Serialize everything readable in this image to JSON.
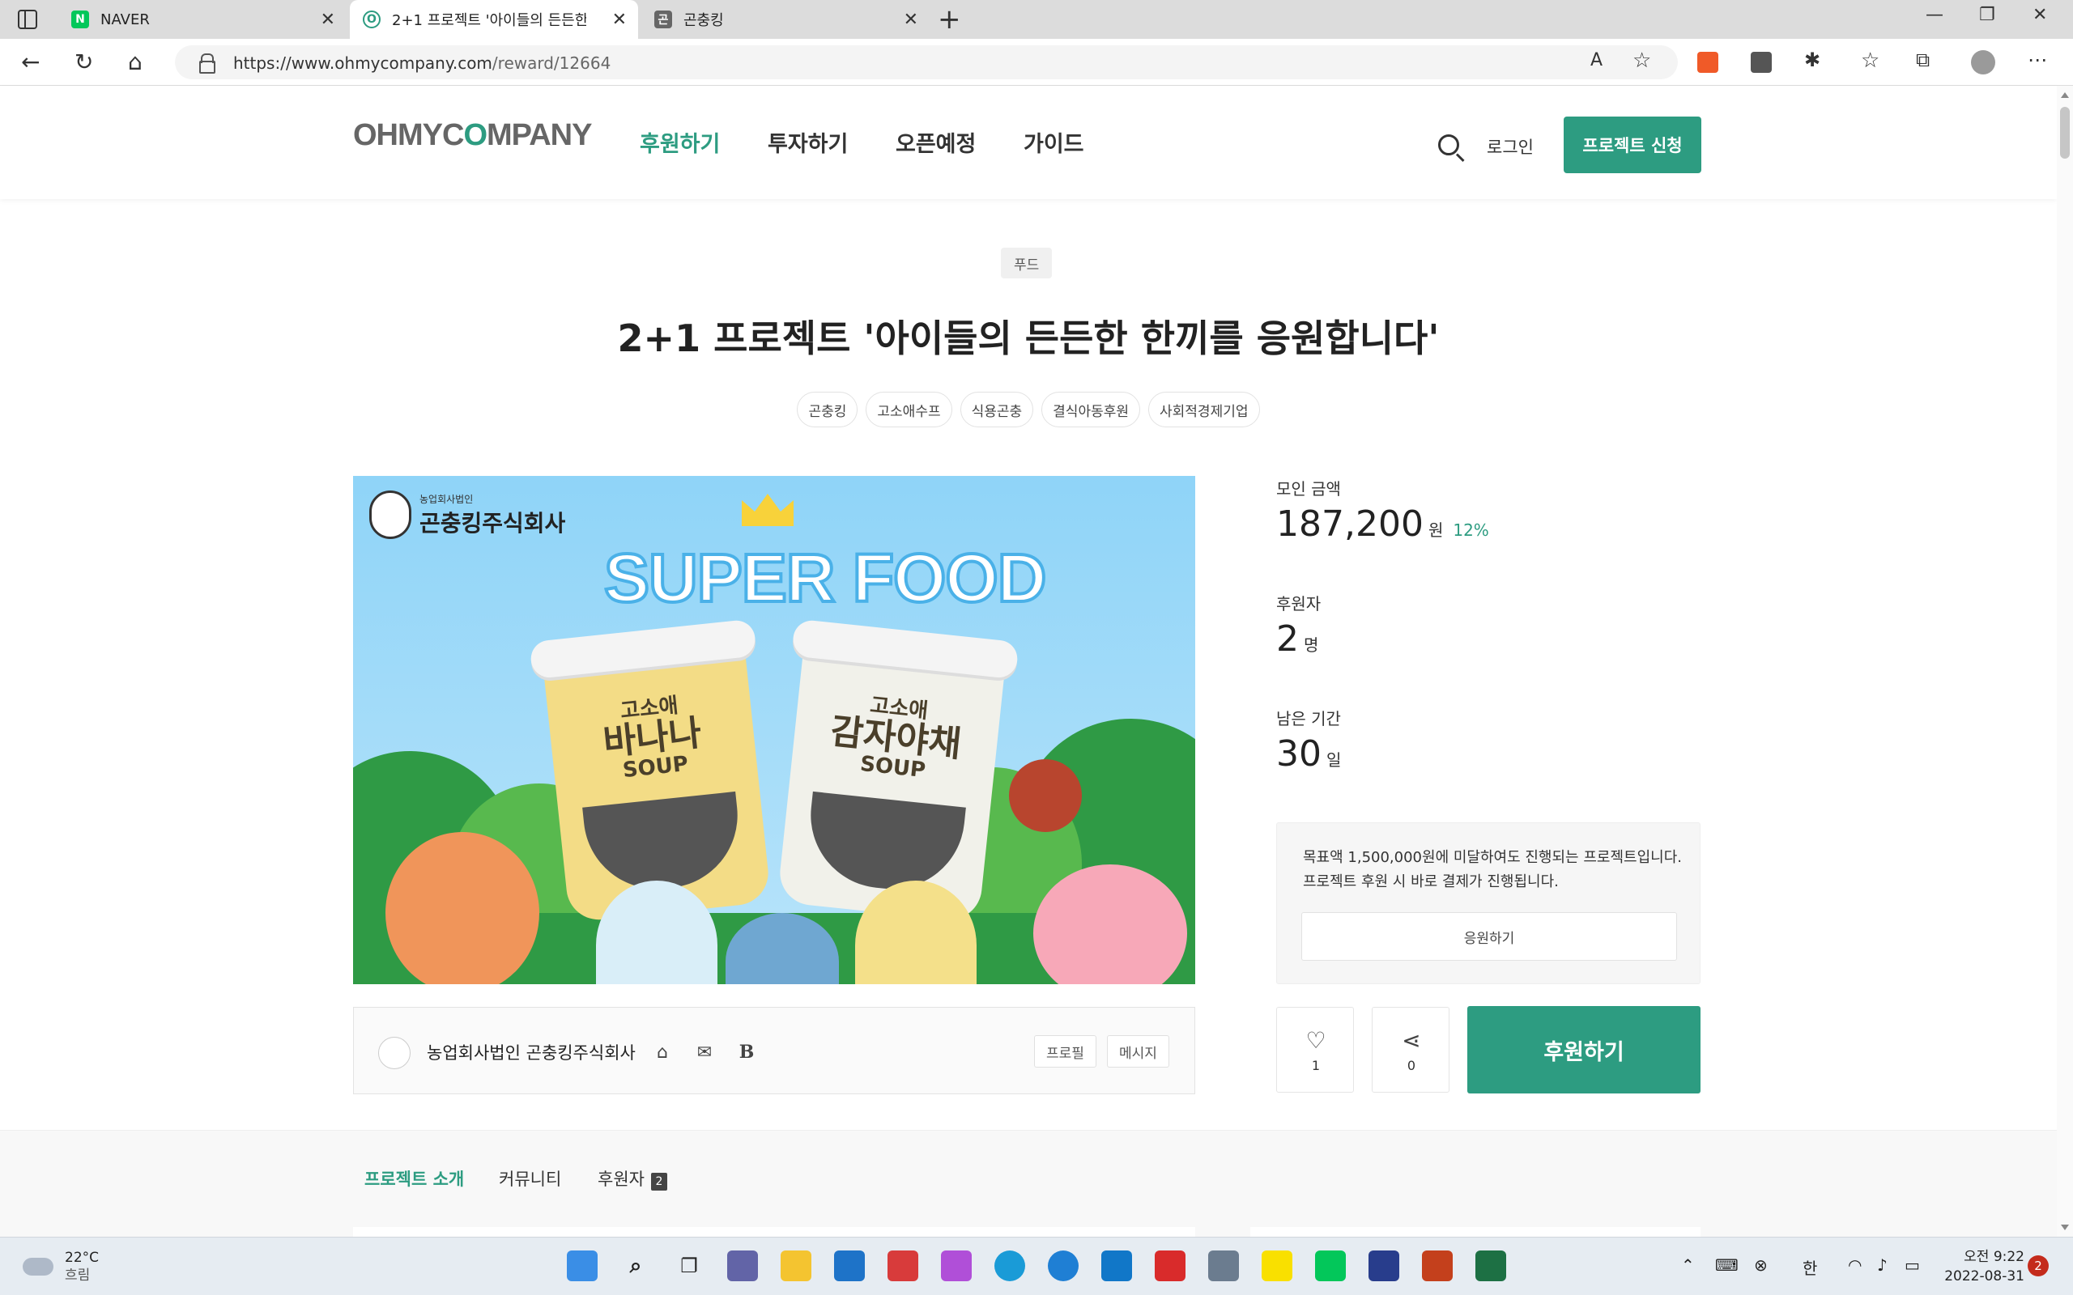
{
  "browser": {
    "tabs": [
      {
        "title": "NAVER",
        "favicon_color": "#03c75a",
        "favicon_text": "N"
      },
      {
        "title": "2+1 프로젝트 '아이들의 든든한 한끼를 응원합니다'",
        "favicon_color": "#2d9c81",
        "favicon_text": "O"
      },
      {
        "title": "곤충킹",
        "favicon_color": "#555555",
        "favicon_text": "곤"
      }
    ],
    "url_host": "https://www.ohmycompany.com",
    "url_path": "/reward/12664"
  },
  "site": {
    "logo_left": "OHMYC",
    "logo_o": "O",
    "logo_right": "MPANY",
    "nav": [
      "후원하기",
      "투자하기",
      "오픈예정",
      "가이드"
    ],
    "login": "로그인",
    "apply": "프로젝트 신청",
    "accent_color": "#2d9c81"
  },
  "project": {
    "category": "푸드",
    "title": "2+1 프로젝트 '아이들의 든든한 한끼를 응원합니다'",
    "tags": [
      "곤충킹",
      "고소애수프",
      "식용곤충",
      "결식아동후원",
      "사회적경제기업"
    ],
    "image": {
      "brand_sub": "농업회사법인",
      "brand_name": "곤충킹주식회사",
      "headline": "SUPER FOOD",
      "cup1_top": "고소애",
      "cup1_main": "바나나",
      "cup1_soup": "SOUP",
      "cup2_top": "고소애",
      "cup2_main": "감자야채",
      "cup2_soup": "SOUP"
    },
    "maker": {
      "name": "농업회사법인 곤충킹주식회사",
      "profile_btn": "프로필",
      "message_btn": "메시지",
      "blog_icon_text": "B"
    },
    "stats": {
      "raised_label": "모인 금액",
      "raised_value": "187,200",
      "raised_unit": "원",
      "raised_pct": "12%",
      "backers_label": "후원자",
      "backers_value": "2",
      "backers_unit": "명",
      "days_label": "남은 기간",
      "days_value": "30",
      "days_unit": "일"
    },
    "notice": "목표액 1,500,000원에 미달하여도 진행되는 프로젝트입니다. 프로젝트 후원 시 바로 결제가 진행됩니다.",
    "cheer_btn": "응원하기",
    "like_count": "1",
    "share_count": "0",
    "back_btn": "후원하기",
    "section_tabs": [
      {
        "label": "프로젝트 소개"
      },
      {
        "label": "커뮤니티"
      },
      {
        "label": "후원자",
        "badge": "2"
      }
    ]
  },
  "taskbar": {
    "temp": "22°C",
    "condition": "흐림",
    "ime": "한",
    "time": "오전 9:22",
    "date": "2022-08-31",
    "notifications": "2"
  }
}
